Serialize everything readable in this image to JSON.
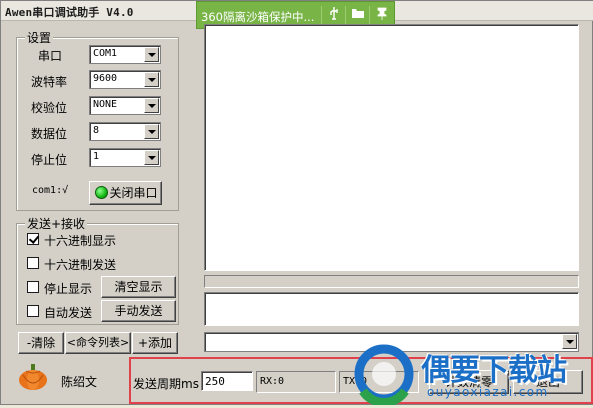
{
  "window": {
    "title": "Awen串口调试助手 V4.0"
  },
  "sandbox_bar": {
    "text": "360隔离沙箱保护中...",
    "icons": [
      "usb-icon",
      "folder-icon",
      "pin-icon"
    ],
    "color": "#79b447"
  },
  "settings": {
    "group_title": "设置",
    "rows": [
      {
        "label": "串口",
        "value": "COM1"
      },
      {
        "label": "波特率",
        "value": "9600"
      },
      {
        "label": "校验位",
        "value": "NONE"
      },
      {
        "label": "数据位",
        "value": "8"
      },
      {
        "label": "停止位",
        "value": "1"
      }
    ],
    "port_status": "com1:√",
    "close_port_label": "关闭串口"
  },
  "send_receive": {
    "group_title": "发送+接收",
    "hex_display": {
      "label": "十六进制显示",
      "checked": true
    },
    "hex_send": {
      "label": "十六进制发送",
      "checked": false
    },
    "stop_display": {
      "label": "停止显示",
      "checked": false
    },
    "clear_display_label": "清空显示",
    "auto_send": {
      "label": "自动发送",
      "checked": false
    },
    "manual_send_label": "手动发送"
  },
  "command_bar": {
    "clear_label": "-清除",
    "list_label": "<命令列表>",
    "add_label": "+添加"
  },
  "author": "陈绍文",
  "bottom": {
    "send_period_label": "发送周期ms",
    "send_period_value": "250",
    "rx_label": "RX:0",
    "tx_label": "TX:0",
    "count_clear_label": "计数清零",
    "exit_label": "退出"
  },
  "watermark": {
    "title": "偶要下载站",
    "subtitle": "ouyaoxiazai.com"
  },
  "colors": {
    "accent_red": "#e0414b",
    "watermark_blue": "#1c6fc7",
    "port_on_green": "#15b815"
  }
}
